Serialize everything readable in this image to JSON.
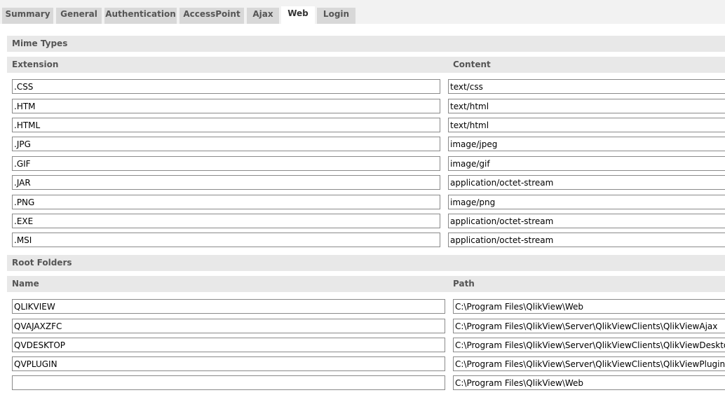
{
  "tabs": [
    {
      "label": "Summary",
      "active": false
    },
    {
      "label": "General",
      "active": false
    },
    {
      "label": "Authentication",
      "active": false
    },
    {
      "label": "AccessPoint",
      "active": false
    },
    {
      "label": "Ajax",
      "active": false
    },
    {
      "label": "Web",
      "active": true
    },
    {
      "label": "Login",
      "active": false
    }
  ],
  "mime_types": {
    "title": "Mime Types",
    "col_extension": "Extension",
    "col_content": "Content",
    "rows": [
      {
        "extension": ".CSS",
        "content": "text/css"
      },
      {
        "extension": ".HTM",
        "content": "text/html"
      },
      {
        "extension": ".HTML",
        "content": "text/html"
      },
      {
        "extension": ".JPG",
        "content": "image/jpeg"
      },
      {
        "extension": ".GIF",
        "content": "image/gif"
      },
      {
        "extension": ".JAR",
        "content": "application/octet-stream"
      },
      {
        "extension": ".PNG",
        "content": "image/png"
      },
      {
        "extension": ".EXE",
        "content": "application/octet-stream"
      },
      {
        "extension": ".MSI",
        "content": "application/octet-stream"
      }
    ]
  },
  "root_folders": {
    "title": "Root Folders",
    "col_name": "Name",
    "col_path": "Path",
    "rows": [
      {
        "name": "QLIKVIEW",
        "path": "C:\\Program Files\\QlikView\\Web"
      },
      {
        "name": "QVAJAXZFC",
        "path": "C:\\Program Files\\QlikView\\Server\\QlikViewClients\\QlikViewAjax"
      },
      {
        "name": "QVDESKTOP",
        "path": "C:\\Program Files\\QlikView\\Server\\QlikViewClients\\QlikViewDesktop"
      },
      {
        "name": "QVPLUGIN",
        "path": "C:\\Program Files\\QlikView\\Server\\QlikViewClients\\QlikViewPlugin"
      },
      {
        "name": "",
        "path": "C:\\Program Files\\QlikView\\Web"
      }
    ]
  }
}
